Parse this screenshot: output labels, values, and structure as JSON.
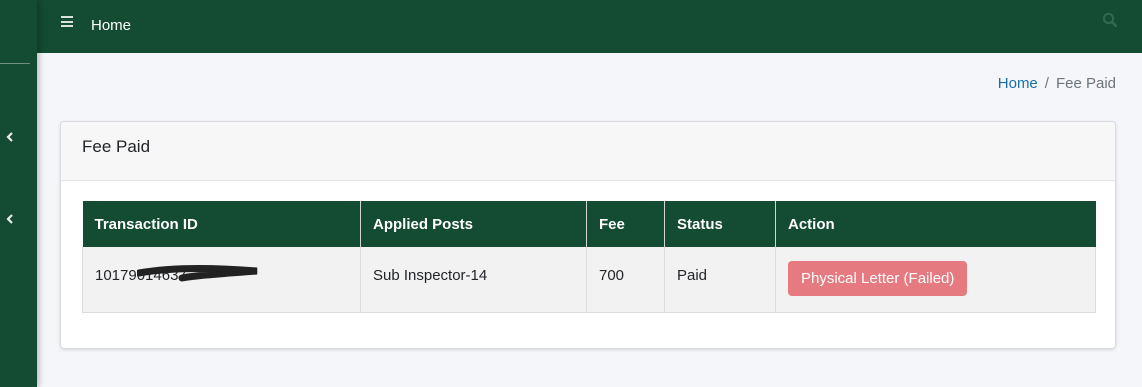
{
  "topbar": {
    "title": "Home",
    "menu_icon": "hamburger-icon",
    "search_icon": "search-icon"
  },
  "sidebar": {
    "chevrons": [
      "chevron-left-icon",
      "chevron-left-icon"
    ]
  },
  "breadcrumb": {
    "home": "Home",
    "separator": "/",
    "current": "Fee Paid"
  },
  "card": {
    "title": "Fee Paid",
    "table": {
      "headers": [
        "Transaction ID",
        "Applied Posts",
        "Fee",
        "Status",
        "Action"
      ],
      "rows": [
        {
          "transaction_id": "10179014637",
          "applied_posts": "Sub Inspector-14",
          "fee": "700",
          "status": "Paid",
          "action": "Physical Letter (Failed)"
        }
      ]
    }
  },
  "colors": {
    "brand_green": "#134b33",
    "page_bg": "#f4f6f9",
    "link": "#1b6fa8",
    "danger_button": "#e57a80"
  }
}
